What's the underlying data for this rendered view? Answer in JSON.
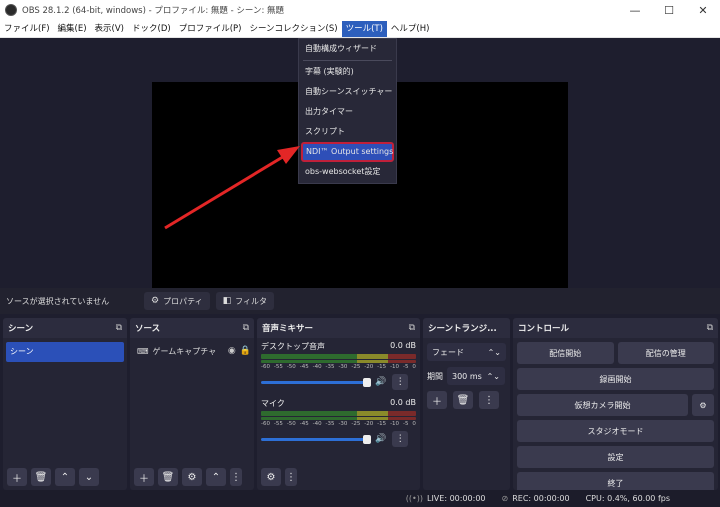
{
  "window": {
    "title": "OBS 28.1.2 (64-bit, windows) - プロファイル: 無題 - シーン: 無題",
    "min": "—",
    "max": "☐",
    "close": "✕"
  },
  "menu": [
    "ファイル(F)",
    "編集(E)",
    "表示(V)",
    "ドック(D)",
    "プロファイル(P)",
    "シーンコレクション(S)",
    "ツール(T)",
    "ヘルプ(H)"
  ],
  "tools_menu": {
    "items": [
      "自動構成ウィザード",
      "字幕 (実験的)",
      "自動シーンスイッチャー",
      "出力タイマー",
      "スクリプト",
      "NDI™ Output settings",
      "obs-websocket設定"
    ]
  },
  "source_toolbar": {
    "message": "ソースが選択されていません",
    "properties": "プロパティ",
    "filters": "フィルタ"
  },
  "scenes": {
    "title": "シーン",
    "items": [
      "シーン"
    ]
  },
  "sources": {
    "title": "ソース",
    "items": [
      "ゲームキャプチャ"
    ]
  },
  "mixer": {
    "title": "音声ミキサー",
    "ticks": [
      "-60",
      "-55",
      "-50",
      "-45",
      "-40",
      "-35",
      "-30",
      "-25",
      "-20",
      "-15",
      "-10",
      "-5",
      "0"
    ],
    "channels": [
      {
        "name": "デスクトップ音声",
        "level": "0.0 dB"
      },
      {
        "name": "マイク",
        "level": "0.0 dB"
      }
    ]
  },
  "transitions": {
    "title": "シーントランジ...",
    "selected": "フェード",
    "duration_label": "期間",
    "duration": "300 ms"
  },
  "controls": {
    "title": "コントロール",
    "start_streaming": "配信開始",
    "manage_broadcast": "配信の管理",
    "start_recording": "録画開始",
    "virtual_camera": "仮想カメラ開始",
    "studio_mode": "スタジオモード",
    "settings": "設定",
    "exit": "終了"
  },
  "status": {
    "live": "LIVE: 00:00:00",
    "rec": "REC: 00:00:00",
    "cpu": "CPU: 0.4%, 60.00 fps"
  },
  "colors": {
    "accent": "#2e4fb8",
    "highlight_border": "#c0203a",
    "arrow": "#e32626"
  }
}
